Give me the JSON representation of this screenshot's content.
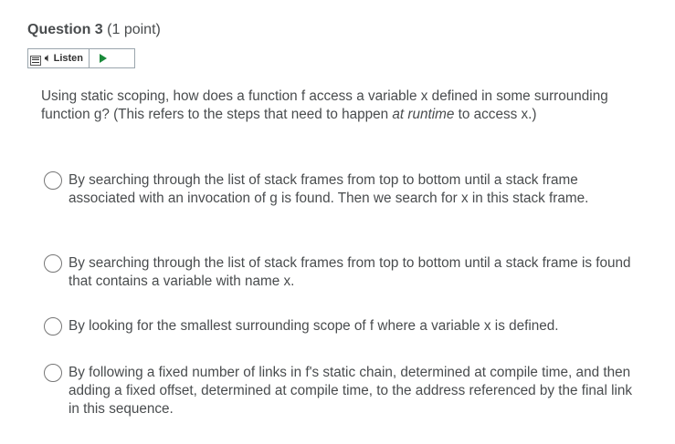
{
  "question": {
    "title": "Question 3",
    "points": "(1 point)",
    "text_before": "Using static scoping, how does a function f access a variable x defined in some surrounding function g?  (This refers to the steps that need to happen ",
    "text_emphasis": "at runtime",
    "text_after": " to access x.)"
  },
  "listen": {
    "label": "Listen"
  },
  "options": [
    {
      "text": "By searching through the list of stack frames from top to bottom until a stack frame associated with an invocation of g is found.  Then we search for x in this stack frame."
    },
    {
      "text": "By searching through the list of stack frames from top to bottom until a stack frame is found that contains a variable with name x."
    },
    {
      "text": "By looking for the smallest surrounding scope of f where a variable x is defined."
    },
    {
      "text": "By following a fixed number of links in f's static chain, determined at compile time, and then adding a fixed offset, determined at compile time, to the address referenced by the final link in this sequence."
    }
  ]
}
